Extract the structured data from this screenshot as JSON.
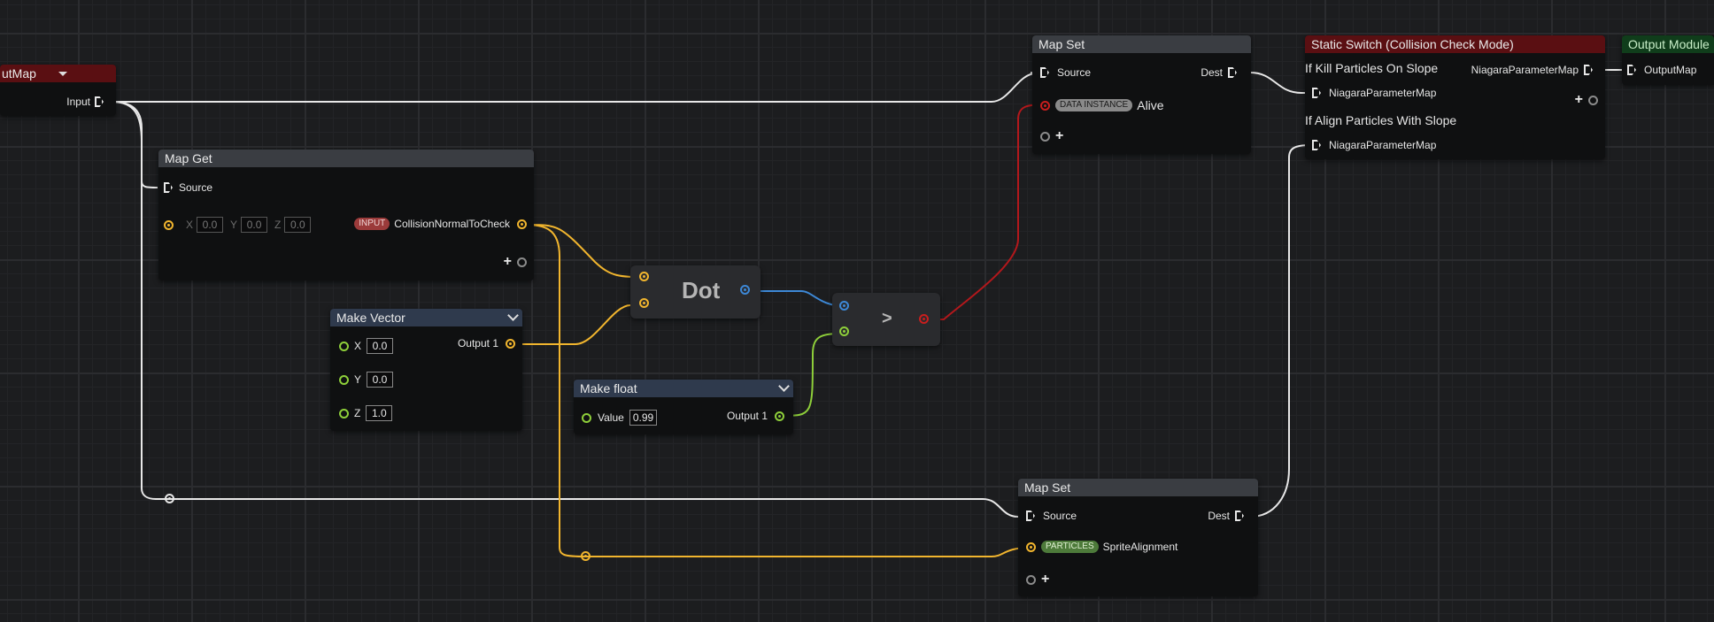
{
  "partial_node": {
    "title": "utMap",
    "pin_label": "Input"
  },
  "map_get": {
    "title": "Map Get",
    "source_label": "Source",
    "x_label": "X",
    "x_value": "0.0",
    "y_label": "Y",
    "y_value": "0.0",
    "z_label": "Z",
    "z_value": "0.0",
    "input_tag": "INPUT",
    "attribute": "CollisionNormalToCheck"
  },
  "make_vector": {
    "title": "Make Vector",
    "x_label": "X",
    "x_value": "0.0",
    "y_label": "Y",
    "y_value": "0.0",
    "z_label": "Z",
    "z_value": "1.0",
    "output_label": "Output 1"
  },
  "dot_node": {
    "label": "Dot"
  },
  "greater_node": {
    "label": ">"
  },
  "make_float": {
    "title": "Make float",
    "value_label": "Value",
    "value": "0.99",
    "output_label": "Output 1"
  },
  "map_set_top": {
    "title": "Map Set",
    "source_label": "Source",
    "dest_label": "Dest",
    "tag": "DATA INSTANCE",
    "attribute": "Alive"
  },
  "map_set_bottom": {
    "title": "Map Set",
    "source_label": "Source",
    "dest_label": "Dest",
    "tag": "PARTICLES",
    "attribute": "SpriteAlignment"
  },
  "static_switch": {
    "title": "Static Switch (Collision Check Mode)",
    "case1": "If Kill Particles On Slope",
    "case1_pin": "NiagaraParameterMap",
    "case2": "If Align Particles With Slope",
    "case2_pin": "NiagaraParameterMap",
    "output_label": "NiagaraParameterMap"
  },
  "output_module": {
    "title": "Output Module",
    "pin_label": "OutputMap"
  },
  "colors": {
    "exec_wire": "#e8e8e8",
    "vector_wire": "#f1b52e",
    "float_wire": "#8ecf3a",
    "dot_wire": "#3d88d6",
    "bool_wire": "#b3181c"
  }
}
